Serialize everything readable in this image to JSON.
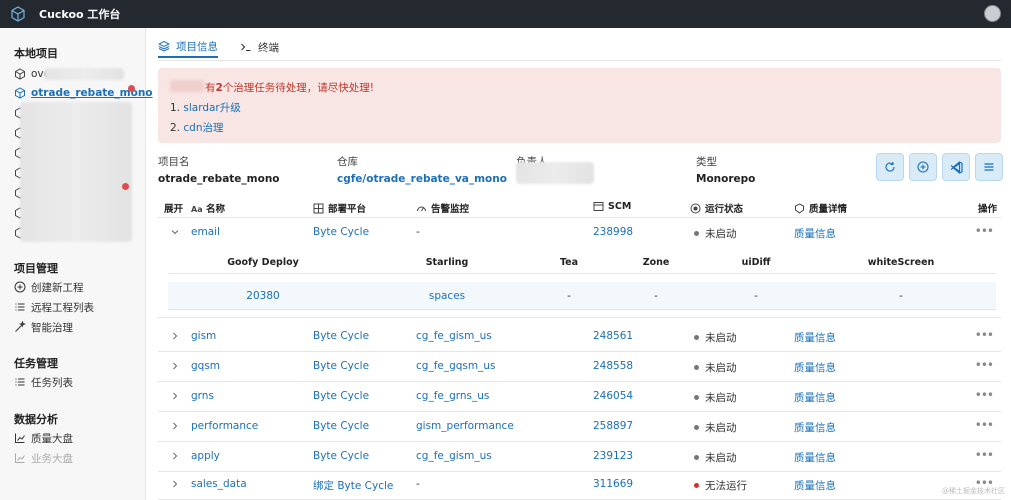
{
  "app": {
    "title": "Cuckoo 工作台"
  },
  "sidebar": {
    "local_title": "本地项目",
    "local_items": [
      {
        "label": "ove"
      },
      {
        "label": "otrade_rebate_mono"
      }
    ],
    "project_title": "项目管理",
    "project_items": [
      {
        "label": "创建新工程",
        "icon": "plus-circle-icon"
      },
      {
        "label": "远程工程列表",
        "icon": "list-icon"
      },
      {
        "label": "智能治理",
        "icon": "magic-wand-icon"
      }
    ],
    "task_title": "任务管理",
    "task_items": [
      {
        "label": "任务列表",
        "icon": "list-icon"
      }
    ],
    "analytics_title": "数据分析",
    "analytics_items": [
      {
        "label": "质量大盘",
        "icon": "chart-icon"
      },
      {
        "label": "业务大盘",
        "icon": "chart-icon"
      }
    ]
  },
  "tabs": [
    {
      "label": "项目信息",
      "icon": "layers-icon"
    },
    {
      "label": "终端",
      "icon": "terminal-icon"
    }
  ],
  "alert": {
    "msg_count": "2",
    "msg_prefix": "有",
    "msg_suffix": "个治理任务待处理，请尽快处理!",
    "links": [
      {
        "num": "1.",
        "label": "slardar升级"
      },
      {
        "num": "2.",
        "label": "cdn治理"
      }
    ]
  },
  "info": {
    "name_label": "项目名",
    "name_value": "otrade_rebate_mono",
    "repo_label": "仓库",
    "repo_value": "cgfe/otrade_rebate_va_mono",
    "owner_label": "负责人",
    "type_label": "类型",
    "type_value": "Monorepo"
  },
  "table": {
    "headers": {
      "expand": "展开",
      "name": "名称",
      "deploy": "部署平台",
      "alarm": "告警监控",
      "scm": "SCM",
      "status": "运行状态",
      "quality": "质量详情",
      "ops": "操作"
    },
    "rows": [
      {
        "name": "email",
        "deploy": "Byte Cycle",
        "alarm": "-",
        "scm": "238998",
        "status": "未启动",
        "quality": "质量信息",
        "status_color": "#777777"
      },
      {
        "name": "gism",
        "deploy": "Byte Cycle",
        "alarm": "cg_fe_gism_us",
        "scm": "248561",
        "status": "未启动",
        "quality": "质量信息",
        "status_color": "#777777"
      },
      {
        "name": "gqsm",
        "deploy": "Byte Cycle",
        "alarm": "cg_fe_gqsm_us",
        "scm": "248558",
        "status": "未启动",
        "quality": "质量信息",
        "status_color": "#777777"
      },
      {
        "name": "grns",
        "deploy": "Byte Cycle",
        "alarm": "cg_fe_grns_us",
        "scm": "246054",
        "status": "未启动",
        "quality": "质量信息",
        "status_color": "#777777"
      },
      {
        "name": "performance",
        "deploy": "Byte Cycle",
        "alarm": "gism_performance",
        "scm": "258897",
        "status": "未启动",
        "quality": "质量信息",
        "status_color": "#777777"
      },
      {
        "name": "apply",
        "deploy": "Byte Cycle",
        "alarm": "cg_fe_gism_us",
        "scm": "239123",
        "status": "未启动",
        "quality": "质量信息",
        "status_color": "#777777"
      },
      {
        "name": "sales_data",
        "deploy": "绑定 Byte Cycle",
        "alarm": "-",
        "scm": "311669",
        "status": "无法运行",
        "quality": "质量信息",
        "status_color": "#d0342c"
      }
    ],
    "sub": {
      "headers": [
        "Goofy Deploy",
        "Starling",
        "Tea",
        "Zone",
        "uiDiff",
        "whiteScreen"
      ],
      "values": [
        "20380",
        "spaces",
        "-",
        "-",
        "-",
        "-"
      ]
    }
  },
  "watermark": "@稀土掘金技术社区"
}
